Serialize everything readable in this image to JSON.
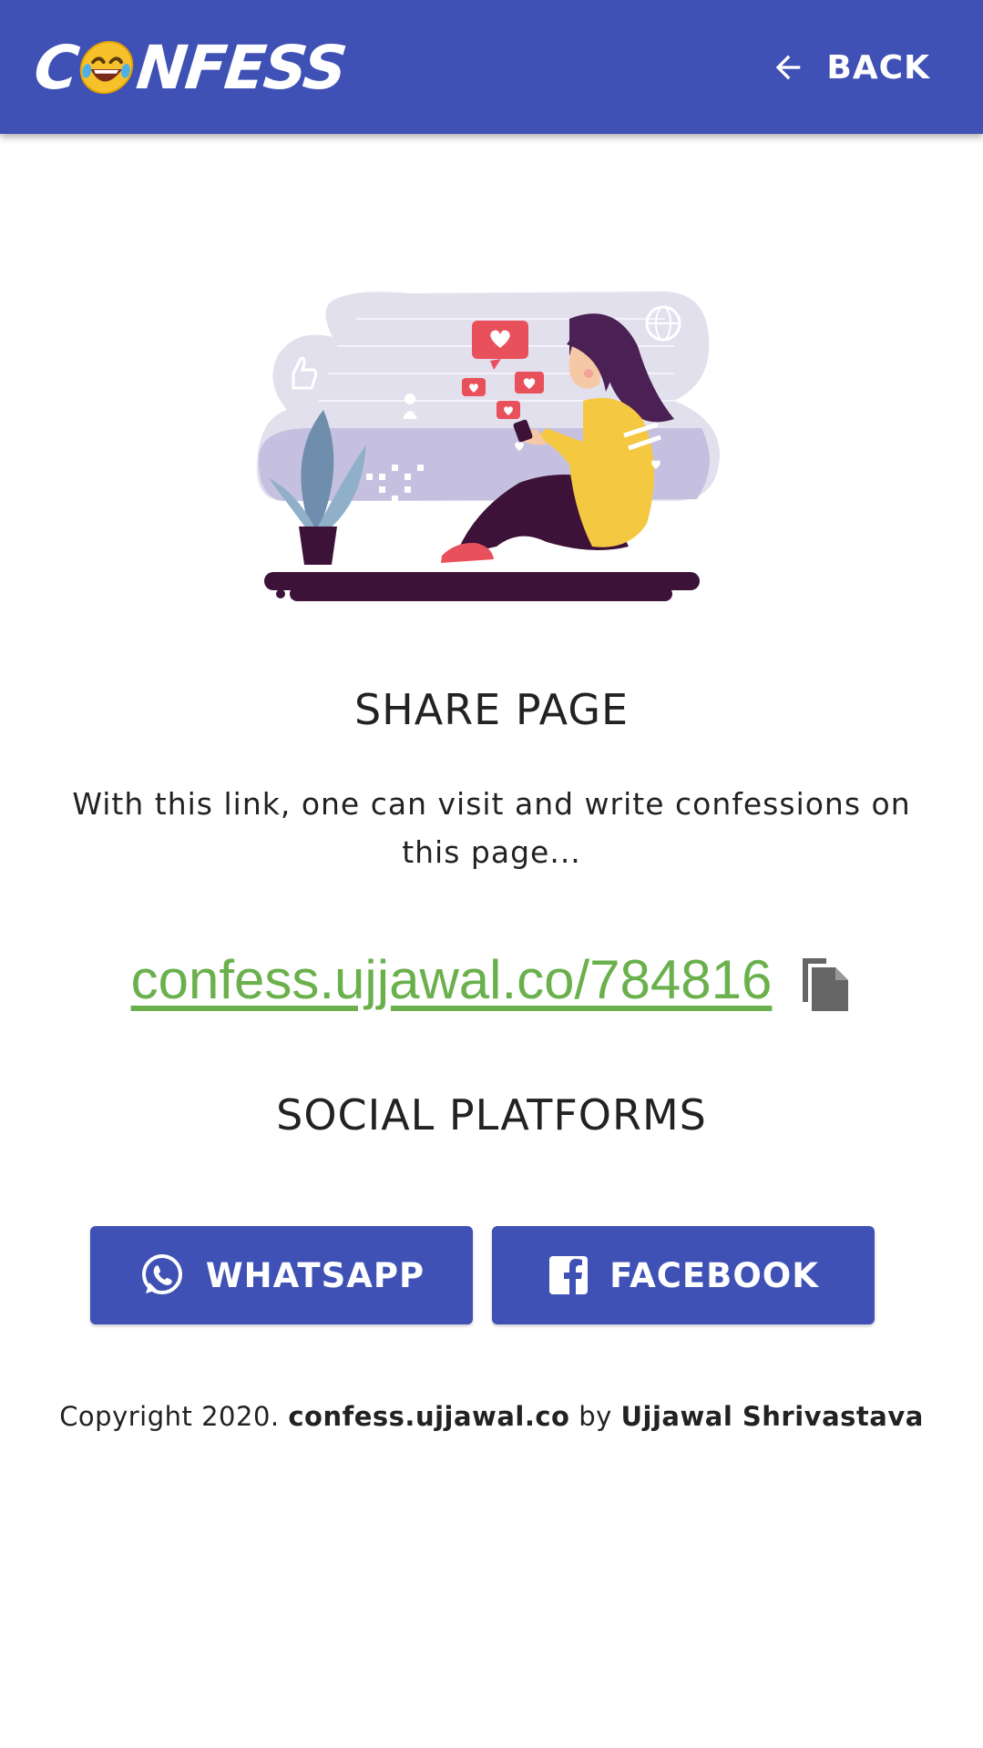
{
  "header": {
    "logo_text_before": "C",
    "logo_text_after": "NFESS",
    "back_label": "BACK"
  },
  "share": {
    "heading": "SHARE PAGE",
    "description": "With this link, one can visit and write confessions on this page...",
    "link": "confess.ujjawal.co/784816"
  },
  "social": {
    "heading": "SOCIAL PLATFORMS",
    "whatsapp_label": "WHATSAPP",
    "facebook_label": "FACEBOOK"
  },
  "footer": {
    "prefix": "Copyright 2020.",
    "site": "confess.ujjawal.co",
    "by": "by",
    "author": "Ujjawal Shrivastava"
  },
  "colors": {
    "primary": "#3f51b5",
    "link": "#6ab04c"
  },
  "icons": [
    "arrow-left-icon",
    "copy-icon",
    "whatsapp-icon",
    "facebook-icon",
    "laughing-emoji-icon"
  ]
}
